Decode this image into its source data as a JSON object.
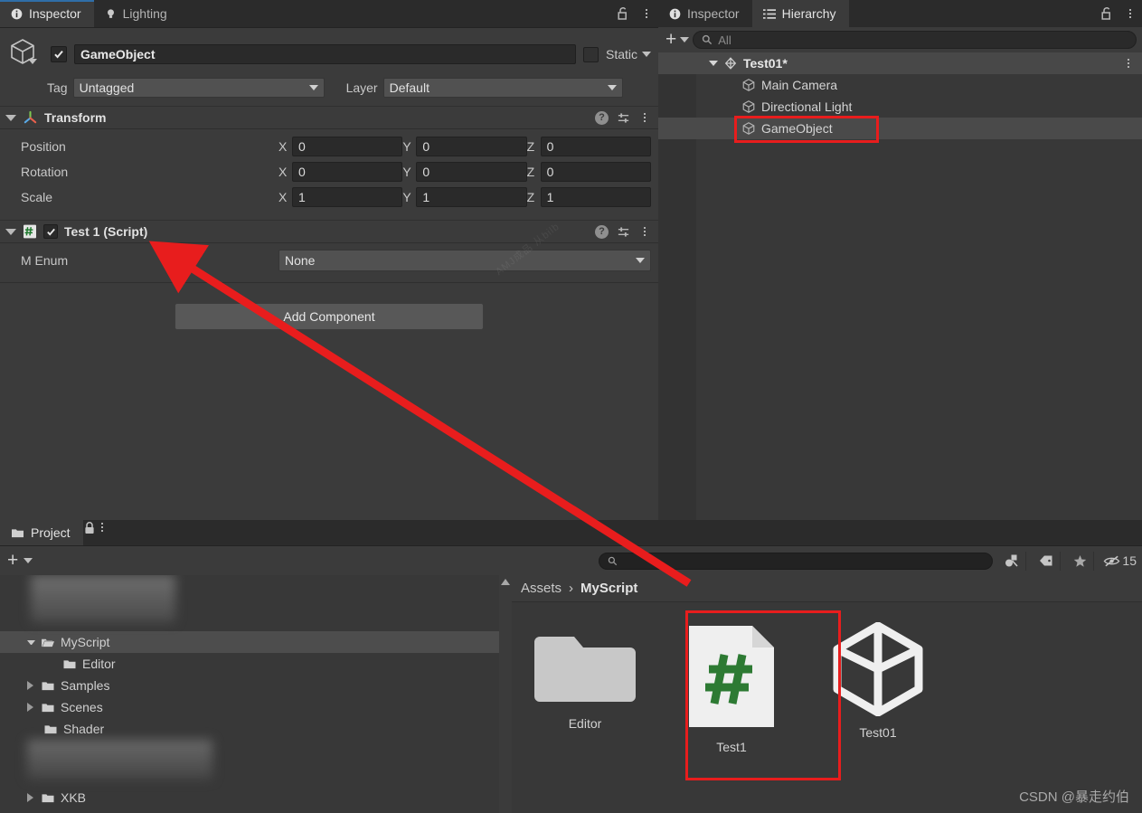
{
  "inspector": {
    "tabs": [
      {
        "label": "Inspector",
        "icon": "info-icon",
        "active": true
      },
      {
        "label": "Lighting",
        "icon": "light-bulb-icon",
        "active": false
      }
    ],
    "lock_icon": "unlocked-padlock-icon",
    "menu_icon": "kebab-menu-icon",
    "gameobject": {
      "icon": "cube-icon",
      "enabled_checkbox": true,
      "name": "GameObject",
      "static_label": "Static",
      "static_checked": false,
      "tag_label": "Tag",
      "tag_value": "Untagged",
      "layer_label": "Layer",
      "layer_value": "Default"
    },
    "components": [
      {
        "title": "Transform",
        "icon": "transform-axis-icon",
        "expanded": true,
        "rows": [
          {
            "name": "Position",
            "axes": [
              {
                "label": "X",
                "value": "0"
              },
              {
                "label": "Y",
                "value": "0"
              },
              {
                "label": "Z",
                "value": "0"
              }
            ]
          },
          {
            "name": "Rotation",
            "axes": [
              {
                "label": "X",
                "value": "0"
              },
              {
                "label": "Y",
                "value": "0"
              },
              {
                "label": "Z",
                "value": "0"
              }
            ]
          },
          {
            "name": "Scale",
            "axes": [
              {
                "label": "X",
                "value": "1"
              },
              {
                "label": "Y",
                "value": "1"
              },
              {
                "label": "Z",
                "value": "1"
              }
            ]
          }
        ]
      },
      {
        "title": "Test 1 (Script)",
        "icon": "csharp-script-icon",
        "expanded": true,
        "enabled_checkbox": true,
        "enum_row": {
          "name": "M Enum",
          "value": "None"
        }
      }
    ],
    "help_icon": "help-question-icon",
    "preset_icon": "preset-sliders-icon",
    "add_component_label": "Add Component",
    "ghost_text": "AMJ成品 从bilb"
  },
  "hierarchy": {
    "tabs": [
      {
        "label": "Inspector",
        "icon": "info-icon",
        "active": false
      },
      {
        "label": "Hierarchy",
        "icon": "hierarchy-list-icon",
        "active": true
      }
    ],
    "lock_icon": "unlocked-padlock-icon",
    "menu_icon": "kebab-menu-icon",
    "add_label": "+",
    "search_placeholder": "All",
    "search_icon": "search-icon",
    "rows": [
      {
        "label": "Test01*",
        "icon": "unity-scene-icon",
        "depth": 0,
        "type": "scene",
        "selected": false,
        "expanded": true
      },
      {
        "label": "Main Camera",
        "icon": "cube-icon",
        "depth": 1,
        "type": "gameobject",
        "selected": false
      },
      {
        "label": "Directional Light",
        "icon": "cube-icon",
        "depth": 1,
        "type": "gameobject",
        "selected": false
      },
      {
        "label": "GameObject",
        "icon": "cube-icon",
        "depth": 1,
        "type": "gameobject",
        "selected": true,
        "highlighted": true
      }
    ]
  },
  "project": {
    "tabs": [
      {
        "label": "Project",
        "icon": "folder-icon",
        "active": true
      }
    ],
    "lock_icon": "locked-padlock-icon",
    "menu_icon": "kebab-menu-icon",
    "add_label": "+",
    "search_placeholder": "",
    "search_icon": "search-icon",
    "toolbar_icons": [
      {
        "name": "search-by-type-icon"
      },
      {
        "name": "search-by-label-icon"
      },
      {
        "name": "favorites-star-icon"
      }
    ],
    "hidden_packages_icon": "eye-crossed-icon",
    "hidden_packages_count": "15",
    "tree": [
      {
        "label": "",
        "depth": 1,
        "blurred": true,
        "expandable": false
      },
      {
        "label": "MyScript",
        "depth": 1,
        "icon": "folder-open-icon",
        "expanded": true,
        "selected": true,
        "expandable": true
      },
      {
        "label": "Editor",
        "depth": 2,
        "icon": "folder-icon",
        "expandable": false
      },
      {
        "label": "Samples",
        "depth": 1,
        "icon": "folder-icon",
        "expandable": true
      },
      {
        "label": "Scenes",
        "depth": 1,
        "icon": "folder-icon",
        "expandable": true
      },
      {
        "label": "Shader",
        "depth": 1,
        "icon": "folder-icon",
        "expandable": false
      },
      {
        "label": "",
        "depth": 1,
        "blurred": true,
        "expandable": false
      },
      {
        "label": "XKB",
        "depth": 1,
        "icon": "folder-icon",
        "expandable": true
      }
    ],
    "breadcrumb": {
      "root": "Assets",
      "separator": "›",
      "current": "MyScript"
    },
    "assets": [
      {
        "label": "Editor",
        "icon": "folder-icon"
      },
      {
        "label": "Test1",
        "icon": "csharp-file-icon",
        "highlighted": true
      },
      {
        "label": "Test01",
        "icon": "unity-scene-icon"
      }
    ]
  },
  "annotations": {
    "arrow_color": "#e81d1d",
    "box_color": "#e81d1d",
    "watermark": "CSDN @暴走约伯"
  }
}
